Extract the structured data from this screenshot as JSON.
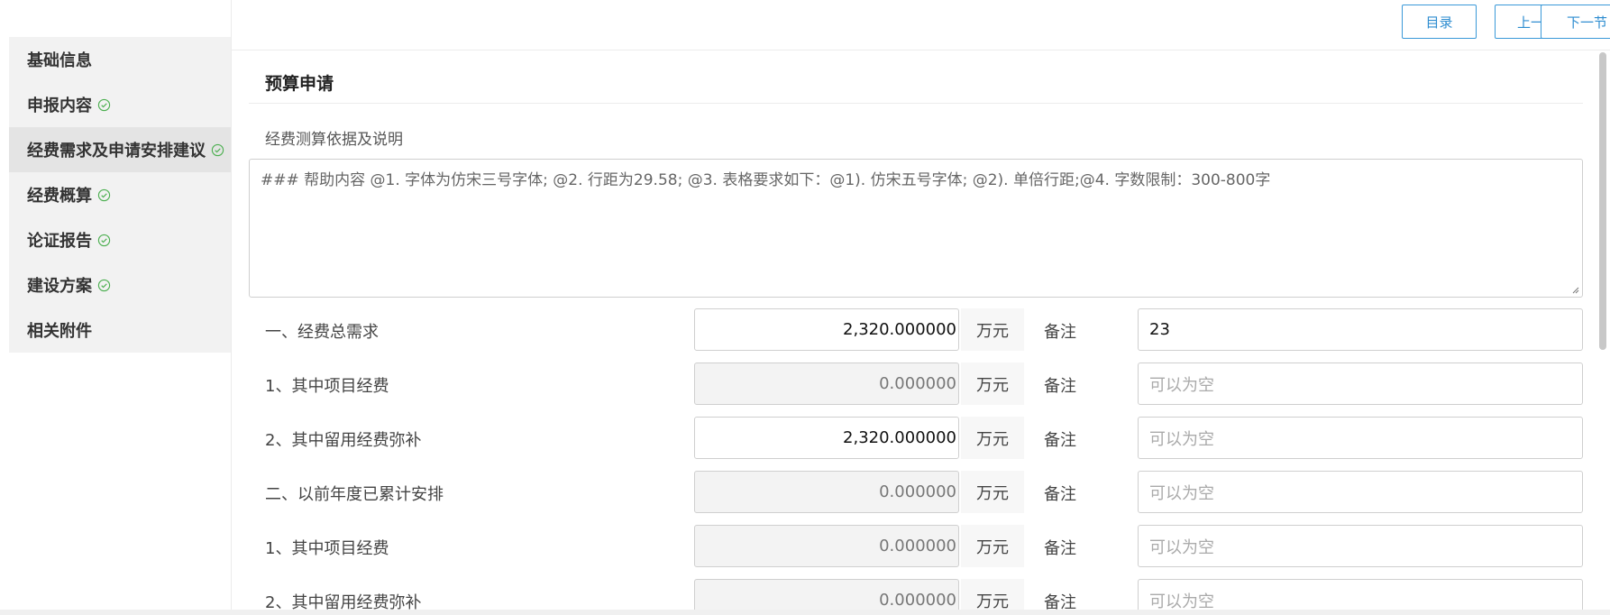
{
  "sidebar": {
    "items": [
      {
        "label": "基础信息",
        "check": false
      },
      {
        "label": "申报内容",
        "check": true
      },
      {
        "label": "经费需求及申请安排建议",
        "check": true
      },
      {
        "label": "经费概算",
        "check": true
      },
      {
        "label": "论证报告",
        "check": true
      },
      {
        "label": "建设方案",
        "check": true
      },
      {
        "label": "相关附件",
        "check": false
      }
    ]
  },
  "topbar": {
    "catalog": "目录",
    "prev": "上一节",
    "next": "下一节"
  },
  "main": {
    "section_title": "预算申请",
    "desc_label": "经费测算依据及说明",
    "textarea_placeholder": "### 帮助内容 @1. 字体为仿宋三号字体; @2. 行距为29.58; @3. 表格要求如下：@1). 仿宋五号字体; @2). 单倍行距;@4. 字数限制：300-800字",
    "unit": "万元",
    "note_label": "备注",
    "rows": [
      {
        "label": "一、经费总需求",
        "value": "2,320.000000",
        "disabled": false,
        "note": "23",
        "note_is_placeholder": false
      },
      {
        "label": "1、其中项目经费",
        "value": "0.000000",
        "disabled": true,
        "note": "可以为空",
        "note_is_placeholder": true
      },
      {
        "label": "2、其中留用经费弥补",
        "value": "2,320.000000",
        "disabled": false,
        "note": "可以为空",
        "note_is_placeholder": true
      },
      {
        "label": "二、以前年度已累计安排",
        "value": "0.000000",
        "disabled": true,
        "note": "可以为空",
        "note_is_placeholder": true
      },
      {
        "label": "1、其中项目经费",
        "value": "0.000000",
        "disabled": true,
        "note": "可以为空",
        "note_is_placeholder": true
      },
      {
        "label": "2、其中留用经费弥补",
        "value": "0.000000",
        "disabled": true,
        "note": "可以为空",
        "note_is_placeholder": true
      }
    ]
  },
  "colors": {
    "accent": "#2d8cd0",
    "check": "#4caf50"
  }
}
